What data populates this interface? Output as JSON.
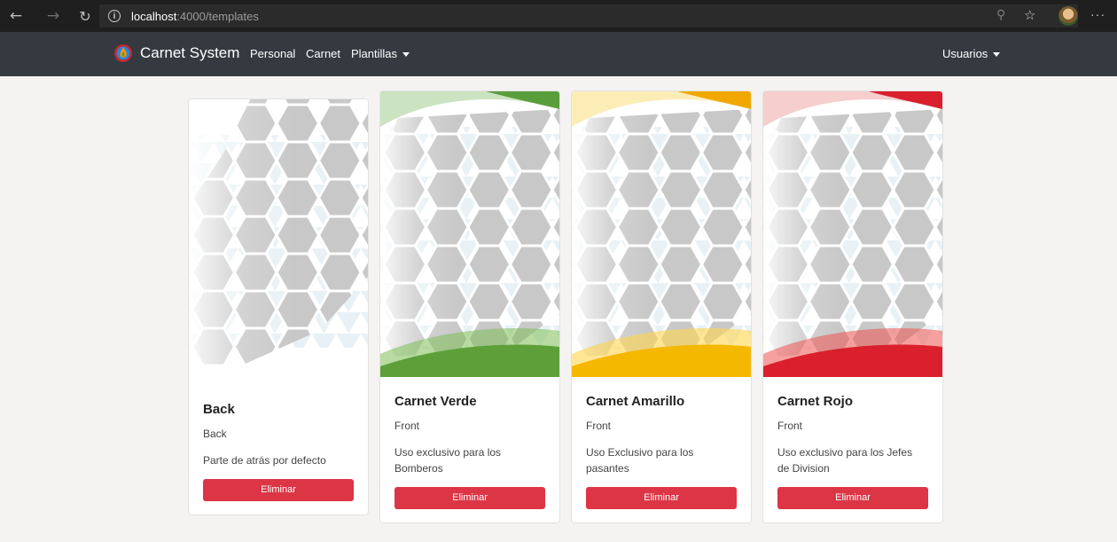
{
  "browser": {
    "url_host": "localhost",
    "url_rest": ":4000/templates"
  },
  "navbar": {
    "brand": "Carnet System",
    "links": [
      "Personal",
      "Carnet",
      "Plantillas"
    ],
    "user_menu": "Usuarios"
  },
  "cards": [
    {
      "title": "Back",
      "type": "Back",
      "description": "Parte de atrás por defecto",
      "button": "Eliminar",
      "accent": "none"
    },
    {
      "title": "Carnet Verde",
      "type": "Front",
      "description": "Uso exclusivo para los Bomberos",
      "button": "Eliminar",
      "accent": "#6ab04c"
    },
    {
      "title": "Carnet Amarillo",
      "type": "Front",
      "description": "Uso Exclusivo para los pasantes",
      "button": "Eliminar",
      "accent": "#f5b800"
    },
    {
      "title": "Carnet Rojo",
      "type": "Front",
      "description": "Uso exclusivo para los Jefes de Division",
      "button": "Eliminar",
      "accent": "#d9202c"
    }
  ],
  "colors": {
    "navbar": "#343a40",
    "danger": "#dc3545",
    "page_bg": "#f4f3f1"
  }
}
